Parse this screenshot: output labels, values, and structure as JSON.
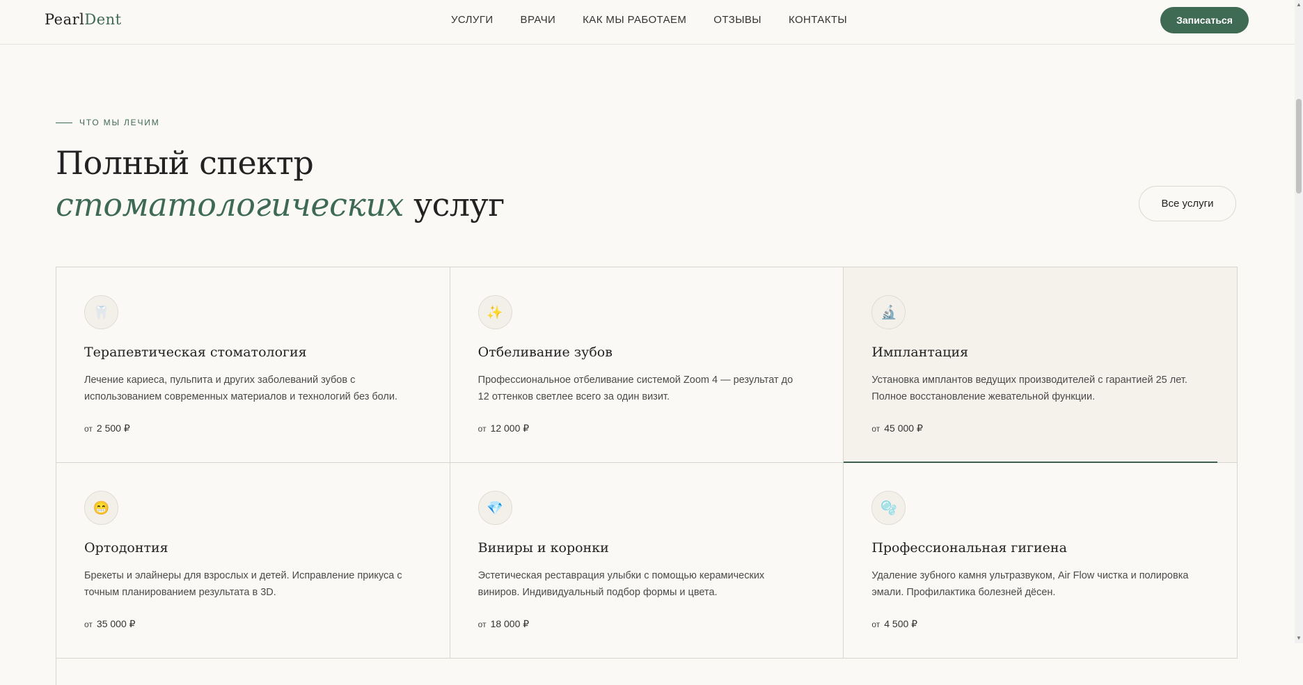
{
  "header": {
    "logo_part1": "Pearl",
    "logo_part2": "Dent",
    "nav": [
      "УСЛУГИ",
      "ВРАЧИ",
      "КАК МЫ РАБОТАЕМ",
      "ОТЗЫВЫ",
      "КОНТАКТЫ"
    ],
    "cta_label": "Записаться"
  },
  "section": {
    "eyebrow": "ЧТО МЫ ЛЕЧИМ",
    "title_line1": "Полный спектр",
    "title_accent": "стоматологических",
    "title_rest": "услуг",
    "all_services_label": "Все услуги"
  },
  "services": [
    {
      "icon": "tooth-icon",
      "glyph": "🦷",
      "title": "Терапевтическая стоматология",
      "description": "Лечение кариеса, пульпита и других заболеваний зубов с использованием современных материалов и технологий без боли.",
      "from": "от",
      "price": "2 500 ₽"
    },
    {
      "icon": "sparkles-icon",
      "glyph": "✨",
      "title": "Отбеливание зубов",
      "description": "Профессиональное отбеливание системой Zoom 4 — результат до 12 оттенков светлее всего за один визит.",
      "from": "от",
      "price": "12 000 ₽"
    },
    {
      "icon": "microscope-icon",
      "glyph": "🔬",
      "title": "Имплантация",
      "description": "Установка имплантов ведущих производителей с гарантией 25 лет. Полное восстановление жевательной функции.",
      "from": "от",
      "price": "45 000 ₽"
    },
    {
      "icon": "grin-icon",
      "glyph": "😁",
      "title": "Ортодонтия",
      "description": "Брекеты и элайнеры для взрослых и детей. Исправление прикуса с точным планированием результата в 3D.",
      "from": "от",
      "price": "35 000 ₽"
    },
    {
      "icon": "gem-icon",
      "glyph": "💎",
      "title": "Виниры и коронки",
      "description": "Эстетическая реставрация улыбки с помощью керамических виниров. Индивидуальный подбор формы и цвета.",
      "from": "от",
      "price": "18 000 ₽"
    },
    {
      "icon": "bubble-icon",
      "glyph": "🫧",
      "title": "Профессиональная гигиена",
      "description": "Удаление зубного камня ультразвуком, Air Flow чистка и полировка эмали. Профилактика болезней дёсен.",
      "from": "от",
      "price": "4 500 ₽"
    }
  ],
  "colors": {
    "accent": "#3e6a55",
    "background": "#fbf9f6",
    "active_card": "#f5f2ec"
  }
}
